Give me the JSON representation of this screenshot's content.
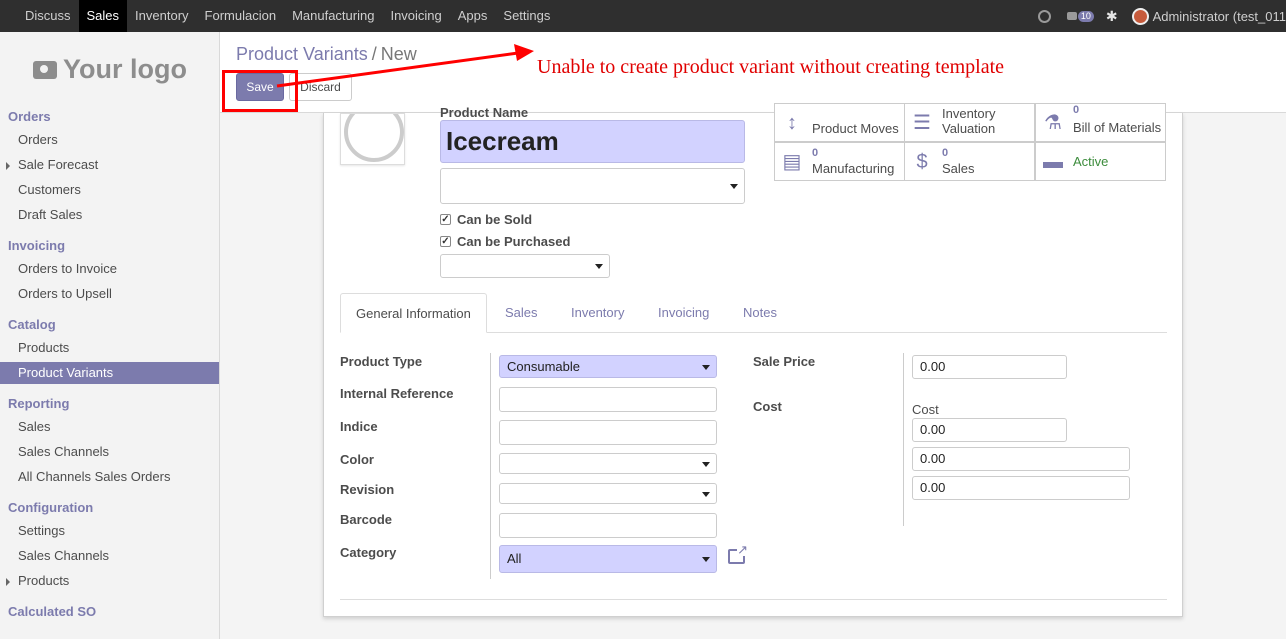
{
  "topbar": {
    "menu": [
      "Discuss",
      "Sales",
      "Inventory",
      "Formulacion",
      "Manufacturing",
      "Invoicing",
      "Apps",
      "Settings"
    ],
    "active": "Sales",
    "chat_count": "10",
    "user": "Administrator (test_011"
  },
  "sidebar": {
    "logo_text": "Your logo",
    "sections": [
      {
        "title": "Orders",
        "items": [
          {
            "label": "Orders"
          },
          {
            "label": "Sale Forecast",
            "expandable": true
          },
          {
            "label": "Customers"
          },
          {
            "label": "Draft Sales"
          }
        ]
      },
      {
        "title": "Invoicing",
        "items": [
          {
            "label": "Orders to Invoice"
          },
          {
            "label": "Orders to Upsell"
          }
        ]
      },
      {
        "title": "Catalog",
        "items": [
          {
            "label": "Products"
          },
          {
            "label": "Product Variants",
            "active": true
          }
        ]
      },
      {
        "title": "Reporting",
        "items": [
          {
            "label": "Sales"
          },
          {
            "label": "Sales Channels"
          },
          {
            "label": "All Channels Sales Orders"
          }
        ]
      },
      {
        "title": "Configuration",
        "items": [
          {
            "label": "Settings"
          },
          {
            "label": "Sales Channels"
          },
          {
            "label": "Products",
            "expandable": true
          }
        ]
      },
      {
        "title": "Calculated SO",
        "items": []
      }
    ]
  },
  "control": {
    "breadcrumb_parent": "Product Variants",
    "breadcrumb_sep": "/",
    "breadcrumb_current": "New",
    "save_label": "Save",
    "discard_label": "Discard",
    "annotation": "Unable to create product variant without creating template"
  },
  "form": {
    "product_name_label": "Product Name",
    "product_name": "Icecream",
    "can_be_sold": "Can be Sold",
    "can_be_purchased": "Can be Purchased",
    "smart_buttons": [
      {
        "label": "Product Moves",
        "num": ""
      },
      {
        "label": "Inventory Valuation",
        "num": ""
      },
      {
        "label": "Bill of Materials",
        "num": "0"
      },
      {
        "label": "Manufacturing",
        "num": "0"
      },
      {
        "label": "Sales",
        "num": "0"
      },
      {
        "label": "Active",
        "num": ""
      }
    ],
    "tabs": [
      "General Information",
      "Sales",
      "Inventory",
      "Invoicing",
      "Notes"
    ],
    "fields": {
      "product_type_label": "Product Type",
      "product_type_value": "Consumable",
      "internal_ref_label": "Internal Reference",
      "indice_label": "Indice",
      "color_label": "Color",
      "revision_label": "Revision",
      "barcode_label": "Barcode",
      "category_label": "Category",
      "category_value": "All",
      "sale_price_label": "Sale Price",
      "sale_price_value": "0.00",
      "cost_label": "Cost",
      "cost_sublabel": "Cost",
      "cost_value_1": "0.00",
      "cost_value_2": "0.00",
      "cost_value_3": "0.00"
    }
  },
  "colors": {
    "accent": "#7c7bad",
    "annotation": "#e00000",
    "topbar": "#2f2f2f"
  }
}
